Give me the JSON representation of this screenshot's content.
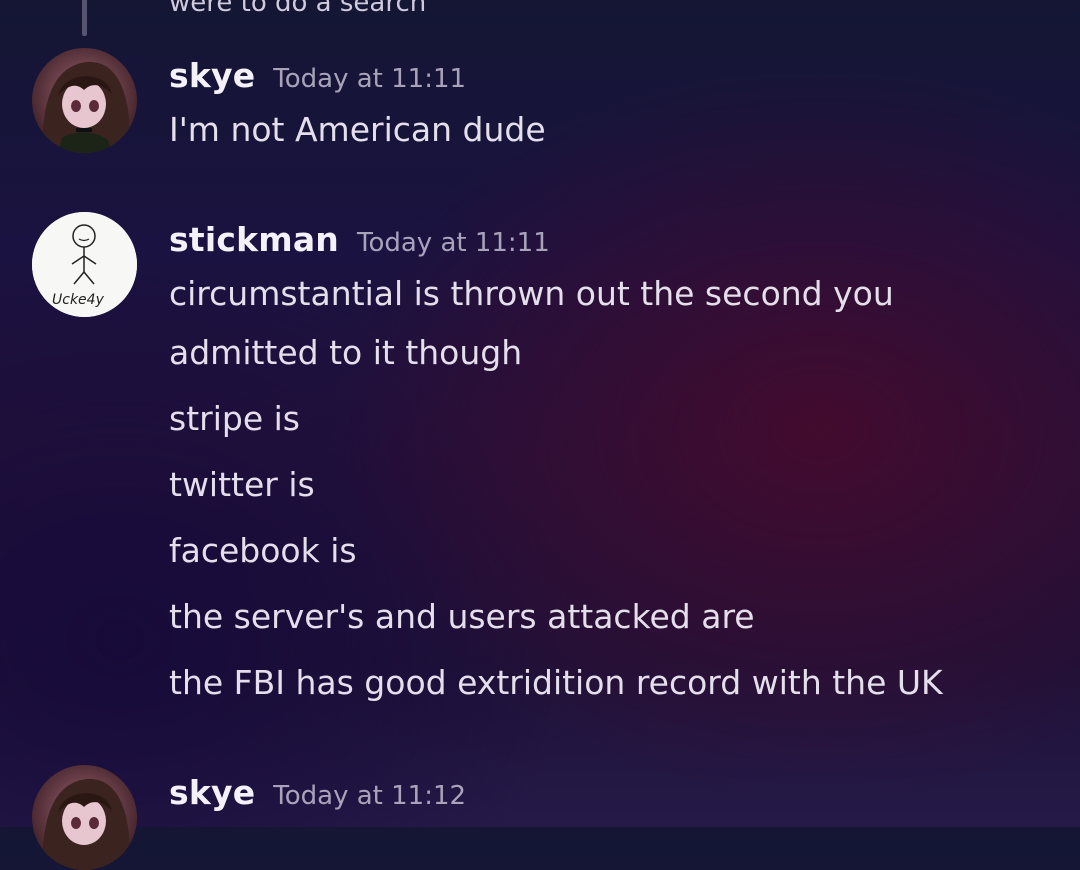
{
  "previous_message": {
    "text": "were to do a search"
  },
  "messages": [
    {
      "username": "skye",
      "timestamp": "Today at 11:11",
      "avatar": "anime-girl-avatar",
      "lines": [
        "I'm not American dude"
      ]
    },
    {
      "username": "stickman",
      "timestamp": "Today at 11:11",
      "avatar": "stickman-drawing-avatar",
      "avatar_text": "Ucke4y",
      "lines": [
        "circumstantial is thrown out the second you",
        "admitted to it though",
        "stripe is",
        "twitter is",
        "facebook is",
        "the server's and users attacked are",
        "the FBI has good extridition record with the UK"
      ]
    },
    {
      "username": "skye",
      "timestamp": "Today at 11:12",
      "avatar": "anime-girl-avatar",
      "lines": []
    }
  ]
}
